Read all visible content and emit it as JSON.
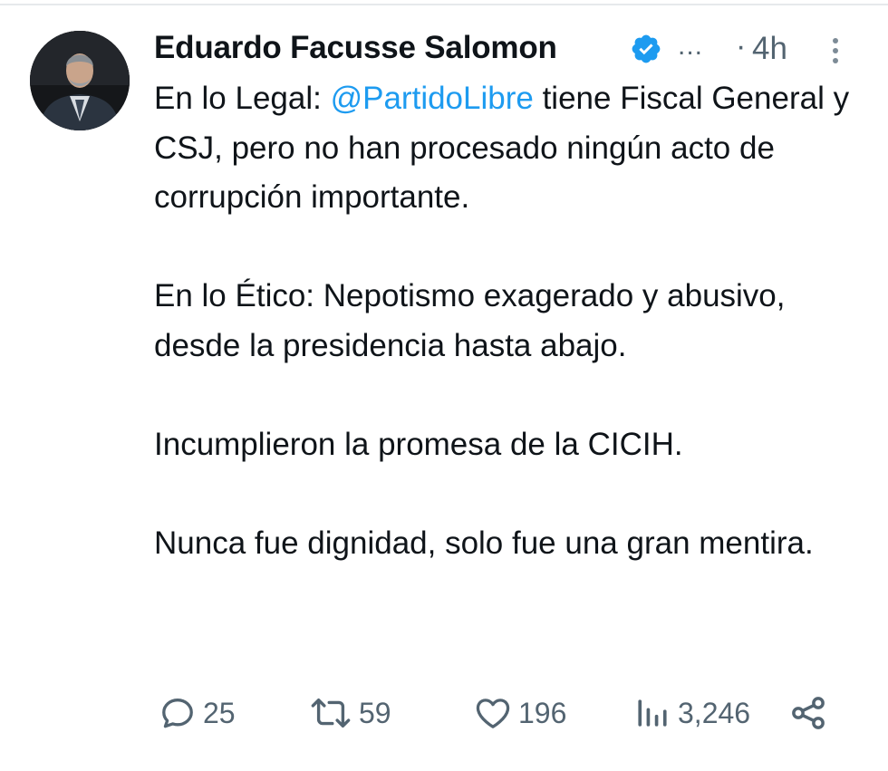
{
  "author": {
    "name": "Eduardo Facusse Salomon",
    "verified_icon": "verified-badge-icon",
    "overflow_text": "...",
    "separator": "·",
    "time": "4h"
  },
  "tweet": {
    "paragraph_1_pre": "En lo Legal: ",
    "mention": "@PartidoLibre",
    "paragraph_1_post": " tiene Fiscal General y CSJ, pero no han procesado ningún acto de corrupción importante.",
    "paragraph_2": "En lo Ético: Nepotismo exagerado y abusivo, desde la presidencia hasta abajo.",
    "paragraph_3": "Incumplieron la promesa de la CICIH.",
    "paragraph_4": "Nunca fue dignidad, solo fue una gran mentira."
  },
  "actions": {
    "replies": "25",
    "retweets": "59",
    "likes": "196",
    "views": "3,246"
  },
  "colors": {
    "text": "#0f1419",
    "secondary": "#536471",
    "accent": "#1d9bf0"
  }
}
